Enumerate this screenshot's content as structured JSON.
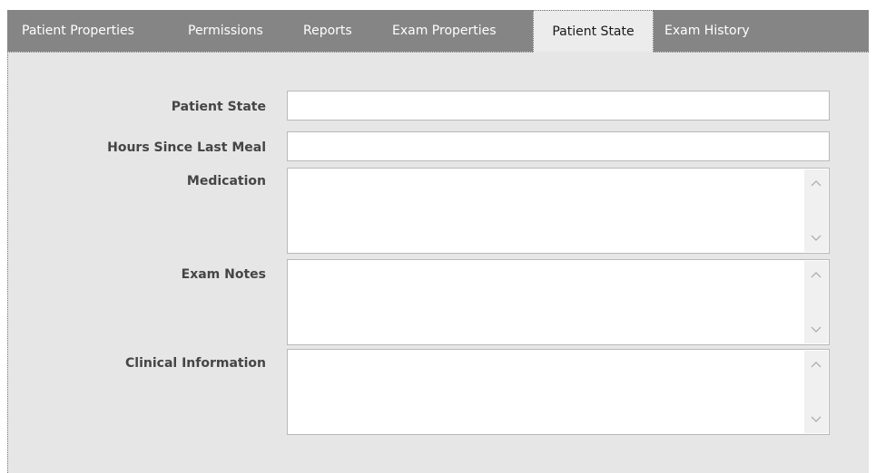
{
  "tabs": [
    {
      "label": "Patient Properties",
      "active": false
    },
    {
      "label": "Permissions",
      "active": false
    },
    {
      "label": "Reports",
      "active": false
    },
    {
      "label": "Exam Properties",
      "active": false
    },
    {
      "label": "Patient State",
      "active": true
    },
    {
      "label": "Exam History",
      "active": false
    }
  ],
  "form": {
    "patient_state": {
      "label": "Patient State",
      "value": ""
    },
    "hours_since_last_meal": {
      "label": "Hours Since Last Meal",
      "value": ""
    },
    "medication": {
      "label": "Medication",
      "value": ""
    },
    "exam_notes": {
      "label": "Exam Notes",
      "value": ""
    },
    "clinical_information": {
      "label": "Clinical Information",
      "value": ""
    }
  },
  "icons": {
    "scroll_up": "chevron-up-icon",
    "scroll_down": "chevron-down-icon"
  },
  "colors": {
    "tab_bar": "#858585",
    "active_tab": "#ececec",
    "panel": "#e6e6e6",
    "label_text": "#454545"
  }
}
